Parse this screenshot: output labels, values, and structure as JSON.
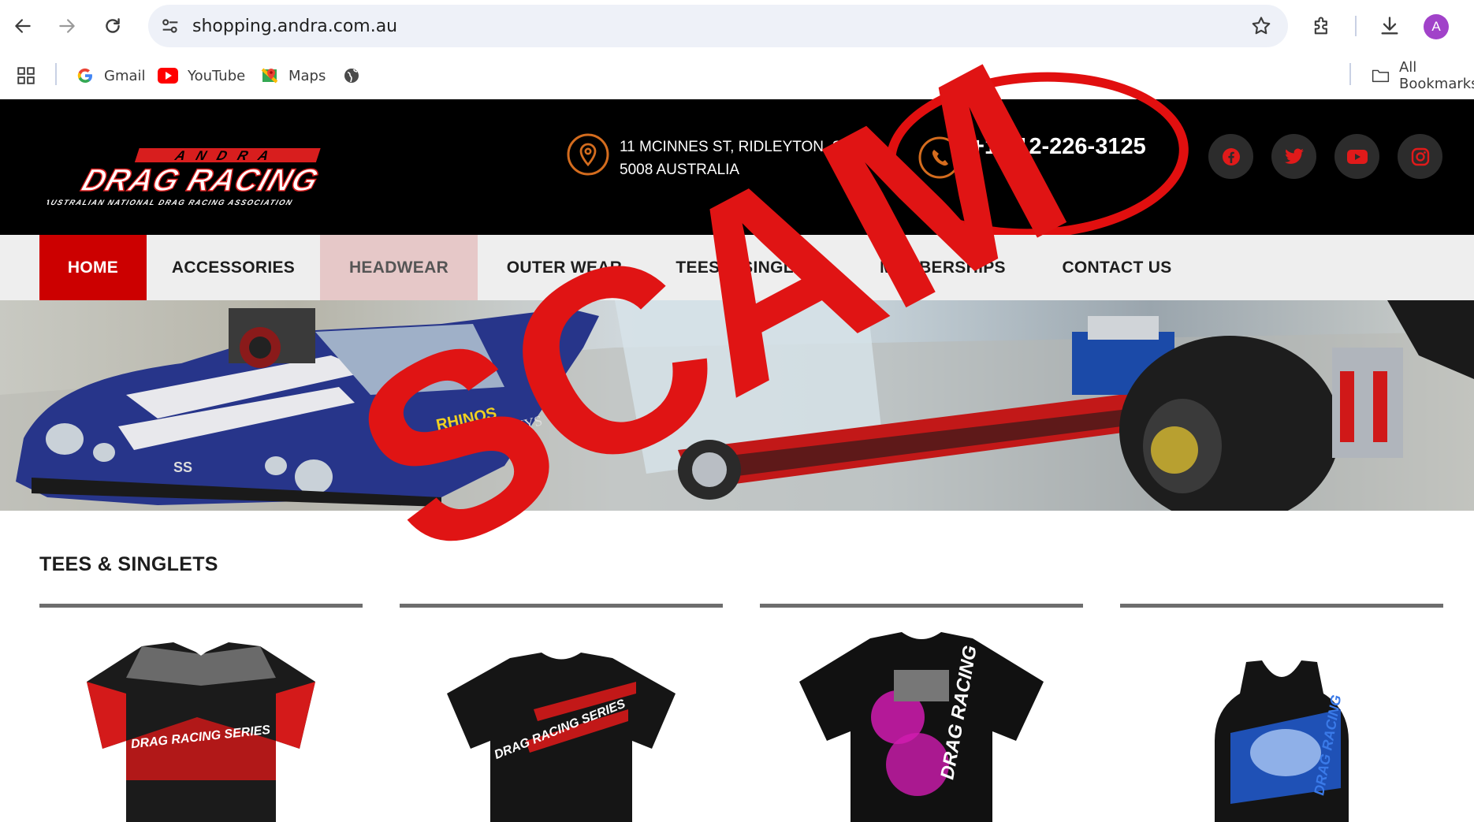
{
  "browser": {
    "url": "shopping.andra.com.au",
    "avatar_letter": "A",
    "bookmarks": [
      {
        "label": "Gmail"
      },
      {
        "label": "YouTube"
      },
      {
        "label": "Maps"
      }
    ],
    "all_bookmarks_label": "All Bookmarks"
  },
  "header": {
    "logo_top": "ANDRA",
    "logo_main": "DRAG RACING",
    "logo_sub": "AUSTRALIAN NATIONAL DRAG RACING ASSOCIATION",
    "address_line1": "11 MCINNES ST, RIDLEYTON, SA,",
    "address_line2": "5008 AUSTRALIA",
    "phone": "+1 212-226-3125",
    "socials": [
      "facebook-icon",
      "twitter-icon",
      "youtube-icon",
      "instagram-icon"
    ]
  },
  "menu": {
    "items": [
      {
        "label": "HOME"
      },
      {
        "label": "ACCESSORIES"
      },
      {
        "label": "HEADWEAR"
      },
      {
        "label": "OUTER WEAR"
      },
      {
        "label": "TEES & SINGLETS"
      },
      {
        "label": "MEMBERSHIPS"
      },
      {
        "label": "CONTACT US"
      }
    ],
    "active_color": "#cc0000",
    "hover_color": "#e6c8c8"
  },
  "hero": {
    "car_badge": "SS",
    "decal_1": "RHINOS",
    "decal_2": "BUSHYS"
  },
  "section": {
    "title": "TEES & SINGLETS"
  },
  "products": [
    {
      "type": "polo",
      "graphic_text": "DRAG RACING SERIES"
    },
    {
      "type": "tee",
      "graphic_text": "DRAG RACING SERIES"
    },
    {
      "type": "tee-pink",
      "graphic_text": "DRAG RACING"
    },
    {
      "type": "singlet",
      "graphic_text": "DRAG RACING"
    }
  ],
  "overlay": {
    "stamp_text": "SCAM",
    "stamp_color": "#e01414"
  }
}
